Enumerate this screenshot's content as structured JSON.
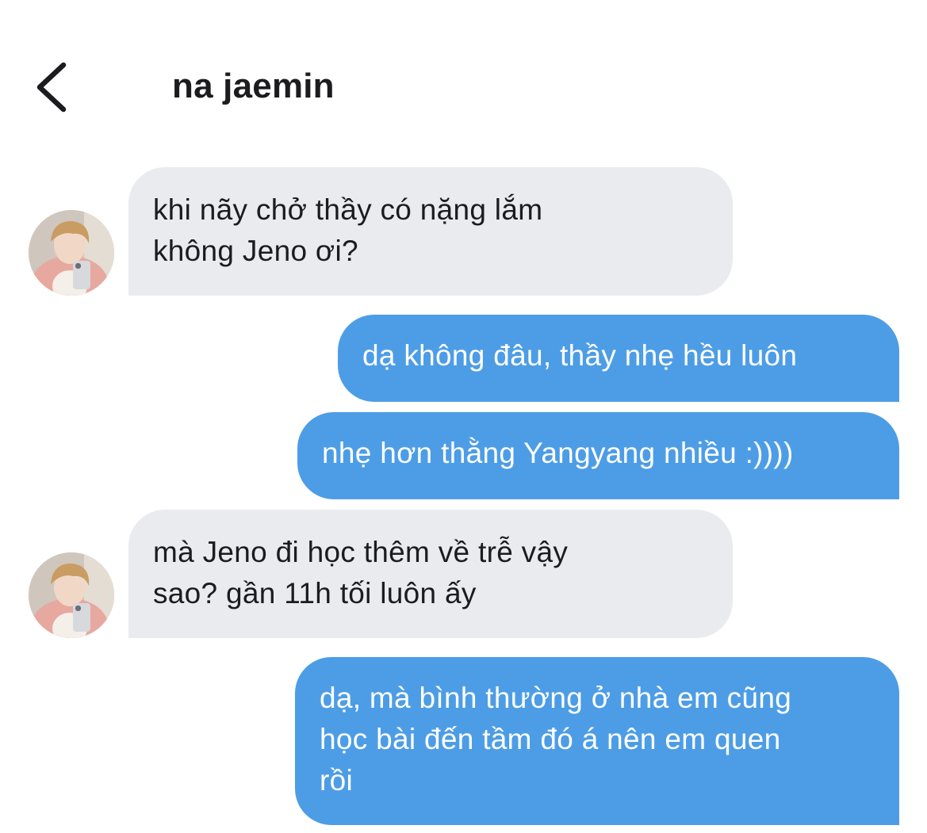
{
  "header": {
    "back_icon": "chevron-left-icon",
    "title": "na jaemin"
  },
  "colors": {
    "incoming_bubble": "#e9ebef",
    "outgoing_bubble": "#4d9de6",
    "incoming_text": "#1c1c1e",
    "outgoing_text": "#ffffff"
  },
  "messages": [
    {
      "direction": "incoming",
      "text": "khi nãy chở thầy có nặng lắm\nkhông Jeno ơi?"
    },
    {
      "direction": "outgoing",
      "text": "dạ không đâu, thầy nhẹ hều luôn"
    },
    {
      "direction": "outgoing",
      "text": "nhẹ hơn thằng Yangyang nhiều :))))"
    },
    {
      "direction": "incoming",
      "text": "mà Jeno đi học thêm về trễ vậy\nsao? gần 11h tối luôn ấy"
    },
    {
      "direction": "outgoing",
      "text": "dạ, mà bình thường ở nhà em cũng\nhọc bài đến tầm đó á nên em quen\nrồi"
    }
  ]
}
